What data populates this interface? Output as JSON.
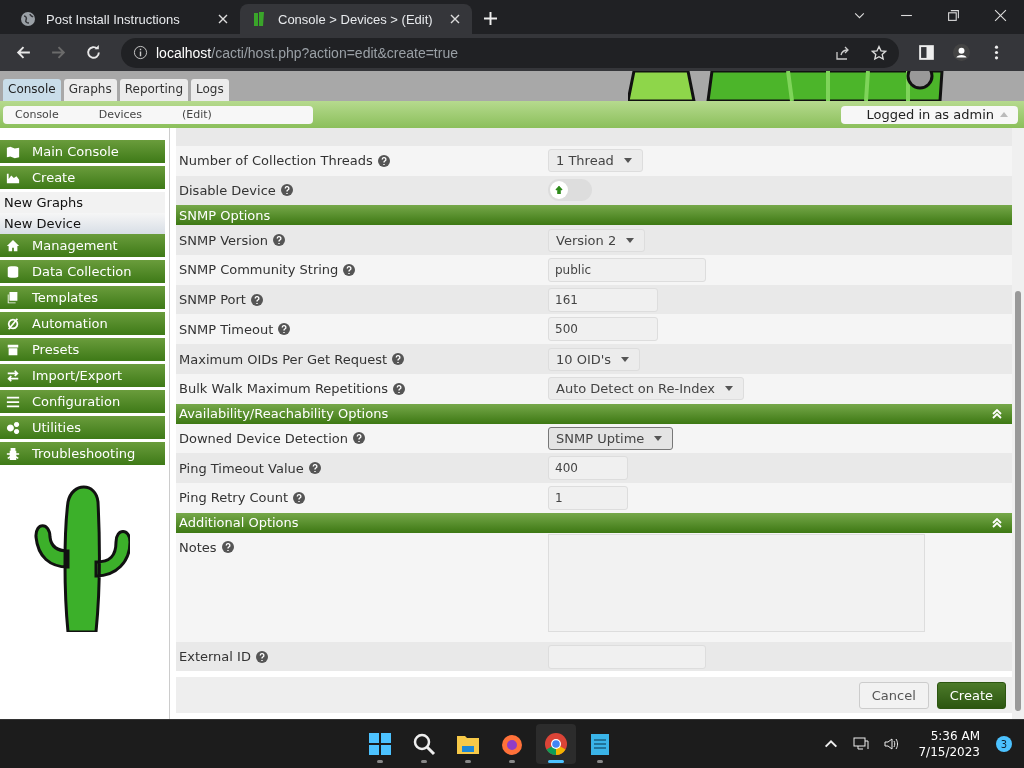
{
  "browser": {
    "tabs": [
      {
        "title": "Post Install Instructions",
        "selected": false
      },
      {
        "title": "Console > Devices > (Edit)",
        "selected": true
      }
    ],
    "address": {
      "host": "localhost",
      "path": "/cacti/host.php?action=edit&create=true"
    }
  },
  "nav_tabs": [
    {
      "label": "Console",
      "selected": true
    },
    {
      "label": "Graphs",
      "selected": false
    },
    {
      "label": "Reporting",
      "selected": false
    },
    {
      "label": "Logs",
      "selected": false
    }
  ],
  "breadcrumbs": [
    "Console",
    "Devices",
    "(Edit)"
  ],
  "user_menu": "Logged in as admin",
  "sidebar": {
    "items": [
      {
        "label": "Main Console",
        "kind": "menu",
        "selected": false
      },
      {
        "label": "Create",
        "kind": "menu",
        "selected": false
      },
      {
        "label": "New Graphs",
        "kind": "sub",
        "selected": false
      },
      {
        "label": "New Device",
        "kind": "sub",
        "selected": true
      },
      {
        "label": "Management",
        "kind": "menu",
        "selected": false
      },
      {
        "label": "Data Collection",
        "kind": "menu",
        "selected": false
      },
      {
        "label": "Templates",
        "kind": "menu",
        "selected": false
      },
      {
        "label": "Automation",
        "kind": "menu",
        "selected": false
      },
      {
        "label": "Presets",
        "kind": "menu",
        "selected": false
      },
      {
        "label": "Import/Export",
        "kind": "menu",
        "selected": false
      },
      {
        "label": "Configuration",
        "kind": "menu",
        "selected": false
      },
      {
        "label": "Utilities",
        "kind": "menu",
        "selected": false
      },
      {
        "label": "Troubleshooting",
        "kind": "menu",
        "selected": false
      }
    ]
  },
  "form": [
    {
      "kind": "select",
      "label": "Number of Collection Threads",
      "value": "1 Thread",
      "focused": false
    },
    {
      "kind": "toggle",
      "label": "Disable Device",
      "on": false
    },
    {
      "kind": "header",
      "title": "SNMP Options",
      "collapsible": false
    },
    {
      "kind": "select",
      "label": "SNMP Version",
      "value": "Version 2",
      "focused": false
    },
    {
      "kind": "textbox",
      "label": "SNMP Community String",
      "value": "public"
    },
    {
      "kind": "numberbox",
      "label": "SNMP Port",
      "value": "161"
    },
    {
      "kind": "numberbox",
      "label": "SNMP Timeout",
      "value": "500"
    },
    {
      "kind": "select",
      "label": "Maximum OIDs Per Get Request",
      "value": "10 OID's",
      "focused": false
    },
    {
      "kind": "select",
      "label": "Bulk Walk Maximum Repetitions",
      "value": "Auto Detect on Re-Index",
      "focused": false
    },
    {
      "kind": "header",
      "title": "Availability/Reachability Options",
      "collapsible": true
    },
    {
      "kind": "select",
      "label": "Downed Device Detection",
      "value": "SNMP Uptime",
      "focused": true
    },
    {
      "kind": "smallbox",
      "label": "Ping Timeout Value",
      "value": "400"
    },
    {
      "kind": "smallbox",
      "label": "Ping Retry Count",
      "value": "1"
    },
    {
      "kind": "header",
      "title": "Additional Options",
      "collapsible": true
    },
    {
      "kind": "textarea",
      "label": "Notes"
    },
    {
      "kind": "textbox",
      "label": "External ID"
    }
  ],
  "buttons": [
    {
      "label": "Cancel",
      "kind": "secondary"
    },
    {
      "label": "Create",
      "kind": "primary"
    }
  ],
  "taskbar": {
    "apps": [
      {
        "kind": "start",
        "selected": false
      },
      {
        "kind": "search",
        "selected": false
      },
      {
        "kind": "files",
        "selected": false
      },
      {
        "kind": "firefox",
        "selected": false
      },
      {
        "kind": "chrome",
        "selected": true
      },
      {
        "kind": "notepad",
        "selected": false
      }
    ],
    "time": "5:36 AM",
    "date": "7/15/2023",
    "notifications": "3"
  }
}
